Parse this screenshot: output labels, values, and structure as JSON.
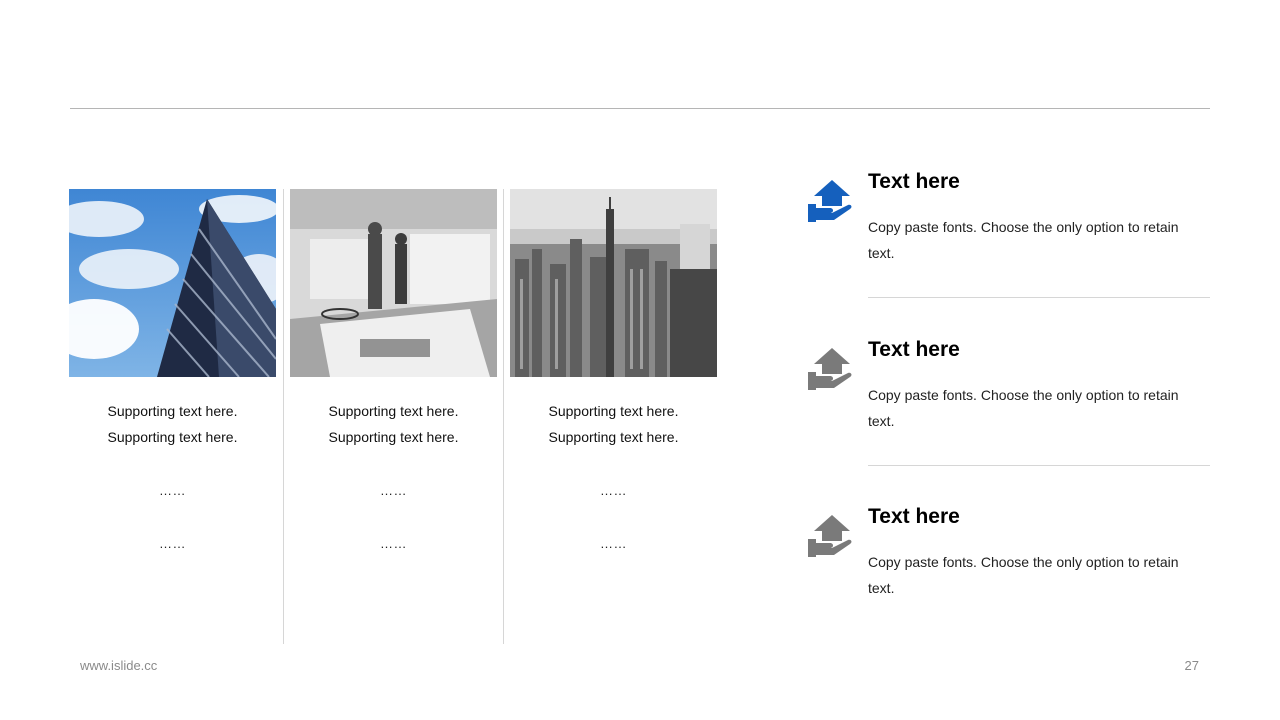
{
  "columns": [
    {
      "image": "glass-skyscraper-photo",
      "lines": [
        "Supporting  text here.",
        "Supporting  text here."
      ],
      "dots": [
        "……",
        "……"
      ]
    },
    {
      "image": "office-contract-photo",
      "lines": [
        "Supporting  text here.",
        "Supporting  text here."
      ],
      "dots": [
        "……",
        "……"
      ]
    },
    {
      "image": "city-skyline-photo",
      "lines": [
        "Supporting  text here.",
        "Supporting  text here."
      ],
      "dots": [
        "……",
        "……"
      ]
    }
  ],
  "features": [
    {
      "icon": "house-hand-icon",
      "color": "#1560bd",
      "title": "Text here",
      "text": "Copy paste fonts. Choose the only option to retain text."
    },
    {
      "icon": "house-hand-icon",
      "color": "#7a7a7a",
      "title": "Text here",
      "text": "Copy paste fonts. Choose the only option to retain text."
    },
    {
      "icon": "house-hand-icon",
      "color": "#7a7a7a",
      "title": "Text here",
      "text": "Copy paste fonts. Choose the only option to retain text."
    }
  ],
  "footer": {
    "url": "www.islide.cc",
    "page": "27"
  }
}
